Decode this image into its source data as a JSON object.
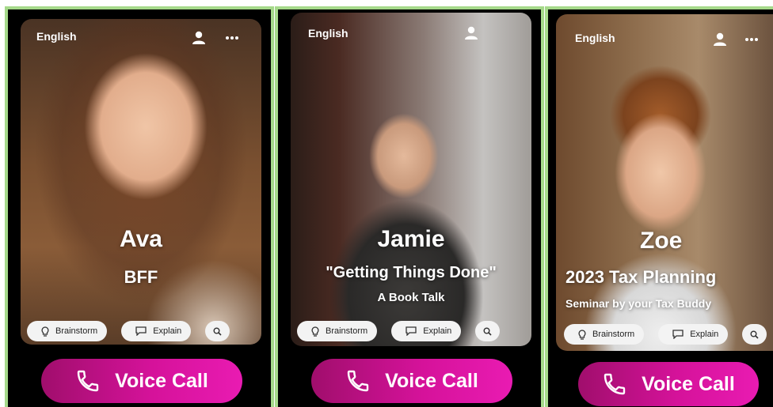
{
  "cards": [
    {
      "language": "English",
      "name": "Ava",
      "subtitle": "BFF",
      "subtitle2": "",
      "chips": [
        "Brainstorm",
        "Explain"
      ],
      "call_label": "Voice Call",
      "show_more": true
    },
    {
      "language": "English",
      "name": "Jamie",
      "subtitle": "\"Getting Things Done\"",
      "subtitle2": "A Book Talk",
      "chips": [
        "Brainstorm",
        "Explain"
      ],
      "call_label": "Voice Call",
      "show_more": false
    },
    {
      "language": "English",
      "name": "Zoe",
      "subtitle": "2023 Tax Planning",
      "subtitle2": "Seminar by your Tax Buddy",
      "chips": [
        "Brainstorm",
        "Explain"
      ],
      "call_label": "Voice Call",
      "show_more": true
    }
  ],
  "icons": {
    "profile": "person-icon",
    "more": "more-dots-icon",
    "brainstorm": "lightbulb-icon",
    "explain": "chat-bubble-icon",
    "search": "search-icon",
    "phone": "phone-icon"
  },
  "colors": {
    "border": "#a5d98a",
    "call_gradient_start": "#a00e6c",
    "call_gradient_end": "#e91bb2"
  }
}
